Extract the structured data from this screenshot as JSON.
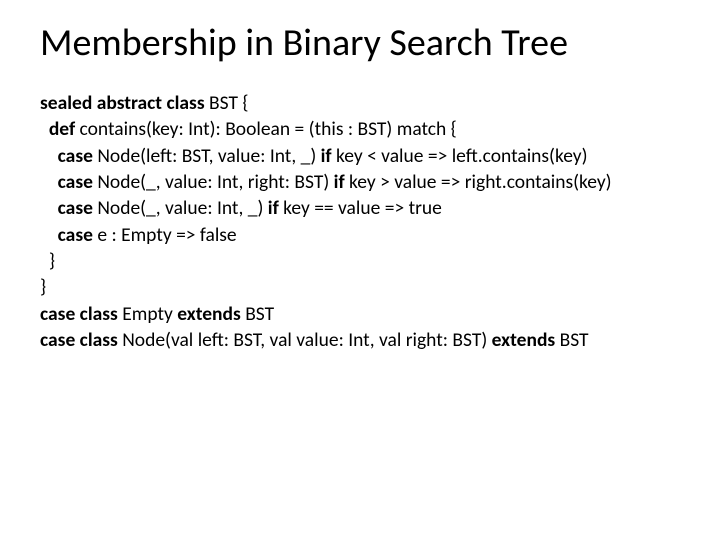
{
  "title": "Membership in Binary Search Tree",
  "code": {
    "l1_kw": "sealed abstract class ",
    "l1_rest": "BST {",
    "l2_indent": "  ",
    "l2_kw": "def ",
    "l2_rest": "contains(key: Int): Boolean = (this : BST) match {",
    "l3_indent": "    ",
    "l3_kw": "case ",
    "l3_mid": "Node(left: BST, value: Int, _) ",
    "l3_kw2": "if ",
    "l3_rest": "key < value => left.contains(key)",
    "l4_indent": "    ",
    "l4_kw": "case ",
    "l4_mid": "Node(_, value: Int, right: BST) ",
    "l4_kw2": "if ",
    "l4_rest": "key > value => right.contains(key)",
    "l5_indent": "    ",
    "l5_kw": "case ",
    "l5_mid": "Node(_, value: Int, _) ",
    "l5_kw2": "if ",
    "l5_rest": "key == value => true",
    "l6_indent": "    ",
    "l6_kw": "case ",
    "l6_rest": "e : Empty => false",
    "l7_indent": "  ",
    "l7_rest": "}",
    "l8_rest": "}",
    "l9_kw": "case class ",
    "l9_mid": "Empty ",
    "l9_kw2": "extends ",
    "l9_rest": "BST",
    "l10_kw": "case class ",
    "l10_mid": "Node(val left: BST, val value: Int, val right: BST) ",
    "l10_kw2": "extends ",
    "l10_rest": "BST"
  }
}
